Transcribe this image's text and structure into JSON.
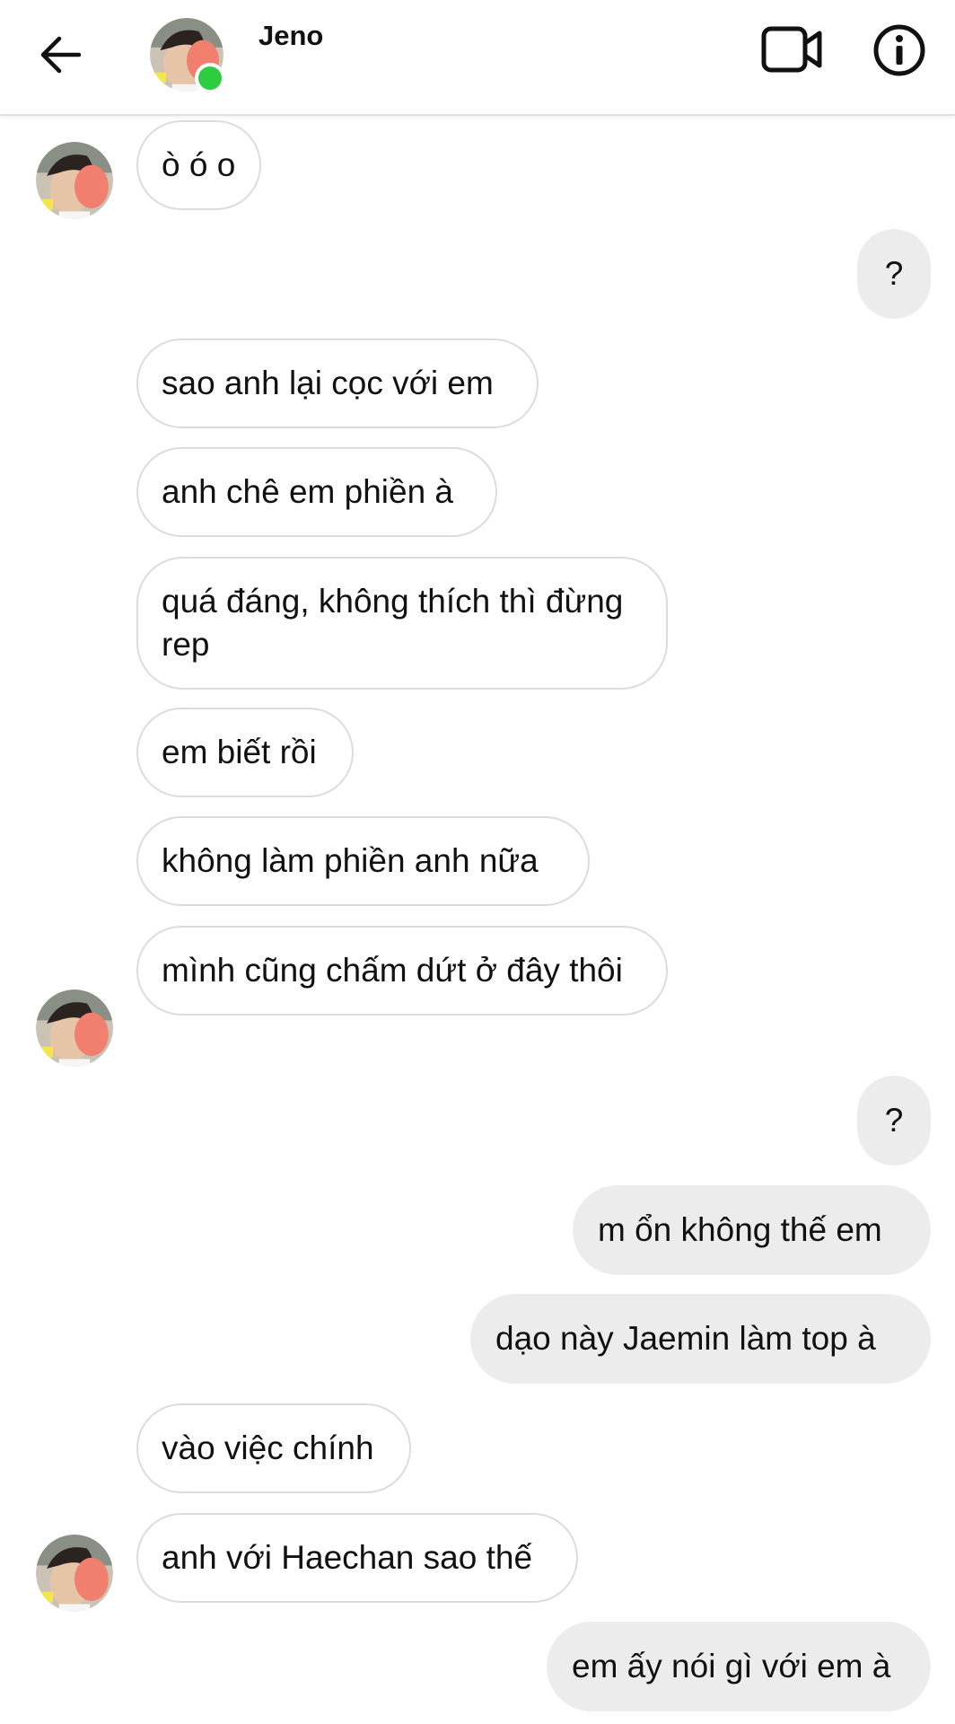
{
  "header": {
    "contact_name": "Jeno"
  },
  "icons": {
    "back": "arrow-left-icon",
    "video": "video-camera-icon",
    "info": "info-icon",
    "online": "online-status-dot"
  },
  "colors": {
    "online": "#2ecc40",
    "outgoing_bubble": "#ececec",
    "incoming_border": "#dcdcdc"
  },
  "messages": [
    {
      "from": "them",
      "text": "ò ó o"
    },
    {
      "from": "me",
      "text": "?"
    },
    {
      "from": "them",
      "text": "sao anh lại cọc với em"
    },
    {
      "from": "them",
      "text": "anh chê em phiền à"
    },
    {
      "from": "them",
      "text": "quá đáng, không thích thì đừng rep"
    },
    {
      "from": "them",
      "text": "em biết rồi"
    },
    {
      "from": "them",
      "text": "không làm phiền anh nữa"
    },
    {
      "from": "them",
      "text": "mình cũng chấm dứt ở đây thôi"
    },
    {
      "from": "me",
      "text": "?"
    },
    {
      "from": "me",
      "text": "m ổn không thế em"
    },
    {
      "from": "me",
      "text": "dạo này Jaemin làm top à"
    },
    {
      "from": "them",
      "text": "vào việc chính"
    },
    {
      "from": "them",
      "text": "anh với Haechan sao thế"
    },
    {
      "from": "me",
      "text": "em ấy nói gì với em à"
    }
  ]
}
